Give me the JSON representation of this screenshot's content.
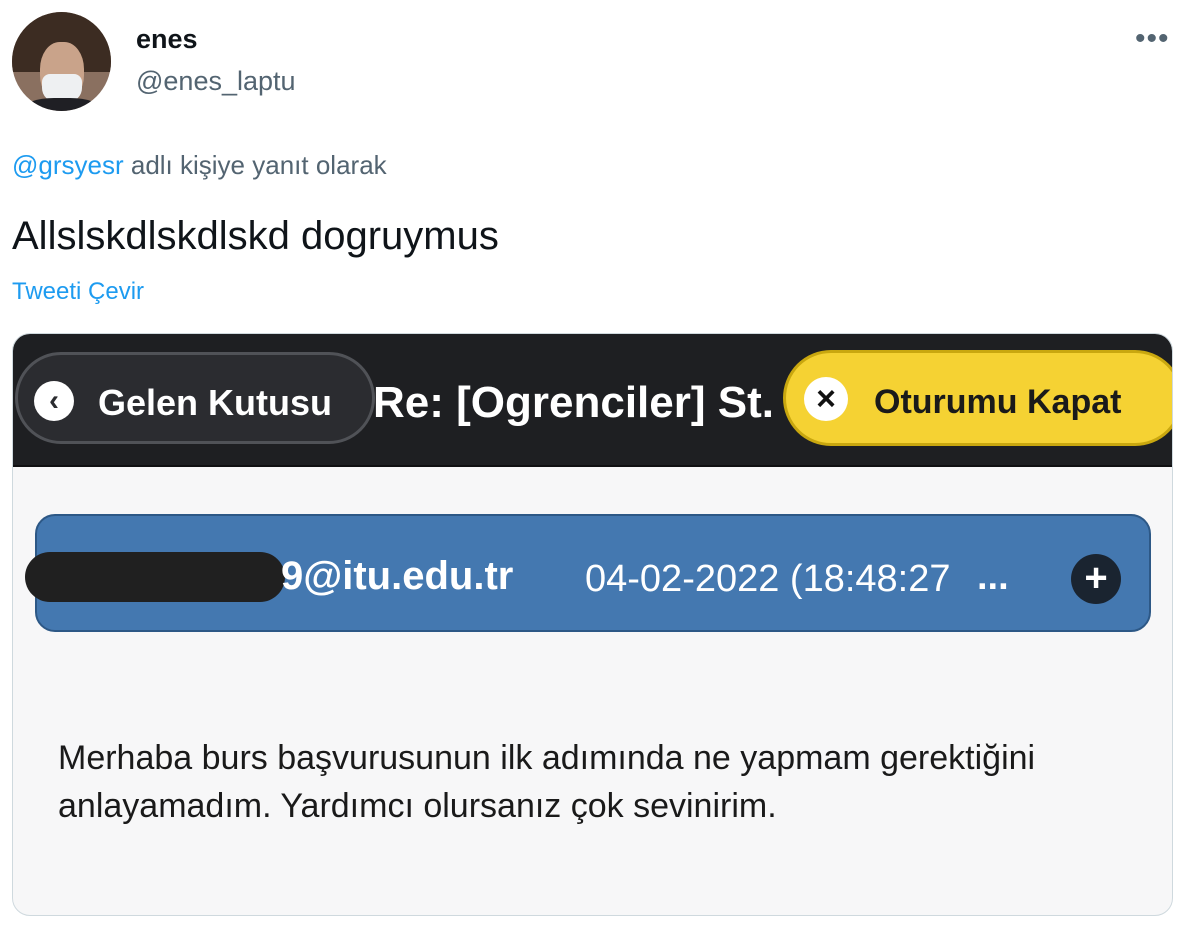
{
  "tweet": {
    "author_name": "enes",
    "author_handle": "@enes_laptu",
    "more_icon": "more-horizontal-icon",
    "reply_mention": "@grsyesr",
    "reply_context": " adlı kişiye yanıt olarak",
    "text": "Allslskdlskdlskd dogruymus",
    "translate_label": "Tweeti Çevir"
  },
  "screenshot": {
    "back_button_label": "Gelen Kutusu",
    "subject": "Re: [Ogrenciler] St.",
    "logout_button_label": "Oturumu Kapat",
    "sender_email": "9@itu.edu.tr",
    "date": "04-02-2022 (18:48:27",
    "date_ellipsis": "...",
    "message": "Merhaba burs başvurusunun ilk adımında ne yapmam gerektiğini anlayamadım. Yardımcı olursanız çok sevinirim."
  },
  "colors": {
    "link": "#1d9bf0",
    "secondary_text": "#536471",
    "toolbar": "#1e1f22",
    "logout_yellow": "#f5d233",
    "sender_bar_blue": "#4478b0"
  }
}
